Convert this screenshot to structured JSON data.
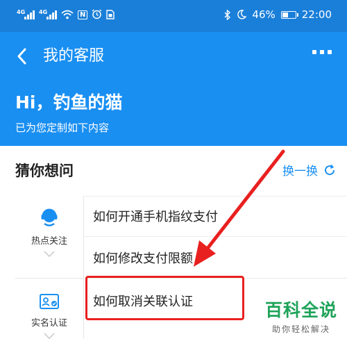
{
  "status_bar": {
    "net1": "4G",
    "net2": "4G",
    "nfc": "N",
    "battery_percent": "46%",
    "battery_level": 0.46,
    "time": "22:00"
  },
  "header": {
    "title": "我的客服",
    "greeting": "Hi，钓鱼的猫",
    "subtitle": "已为您定制如下内容"
  },
  "section": {
    "title": "猜你想问",
    "refresh_label": "换一换"
  },
  "categories": [
    {
      "label": "热点关注",
      "icon": "customer-service-icon"
    },
    {
      "label": "实名认证",
      "icon": "id-card-icon"
    }
  ],
  "questions": [
    "如何开通手机指纹支付",
    "如何修改支付限额",
    "如何取消关联认证"
  ],
  "colors": {
    "status_bar": "#1a7fd9",
    "header": "#1a8ff2",
    "accent": "#1a8ff2",
    "annotation": "#e8201f",
    "watermark": "#1fa35a"
  },
  "watermark": {
    "line1": "百科全说",
    "line2": "助你轻松解决"
  }
}
